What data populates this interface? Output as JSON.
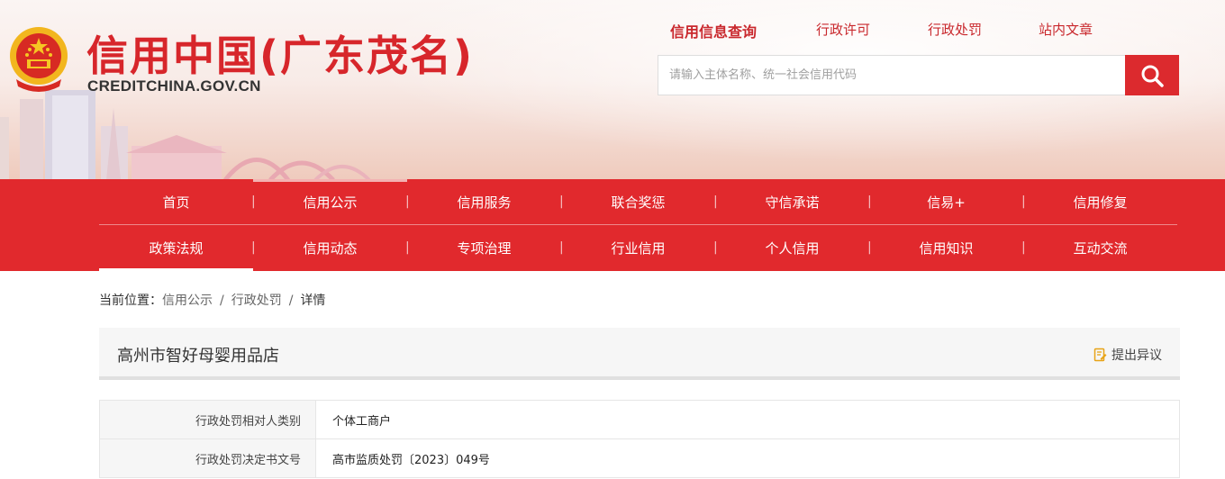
{
  "header": {
    "site_title": "信用中国(广东茂名)",
    "site_domain": "CREDITCHINA.GOV.CN",
    "top_links": [
      "信用信息查询",
      "行政许可",
      "行政处罚",
      "站内文章"
    ],
    "search": {
      "placeholder": "请输入主体名称、统一社会信用代码"
    },
    "icons": {
      "emblem": "national-emblem-icon",
      "search": "search-icon"
    },
    "colors": {
      "brand_red": "#e1292d",
      "title_red": "#d7262b"
    }
  },
  "nav": {
    "row1": [
      "首页",
      "信用公示",
      "信用服务",
      "联合奖惩",
      "守信承诺",
      "信易+",
      "信用修复"
    ],
    "row2": [
      "政策法规",
      "信用动态",
      "专项治理",
      "行业信用",
      "个人信用",
      "信用知识",
      "互动交流"
    ]
  },
  "breadcrumb": {
    "prefix": "当前位置：",
    "items": [
      "信用公示",
      "行政处罚"
    ],
    "separator": "/",
    "current": "详情"
  },
  "detail": {
    "entity_name": "高州市智好母婴用品店",
    "objection_label": "提出异议",
    "objection_icon": "objection-edit-icon",
    "rows": [
      {
        "label": "行政处罚相对人类别",
        "value": "个体工商户"
      },
      {
        "label": "行政处罚决定书文号",
        "value": "高市监质处罚〔2023〕049号"
      }
    ]
  }
}
